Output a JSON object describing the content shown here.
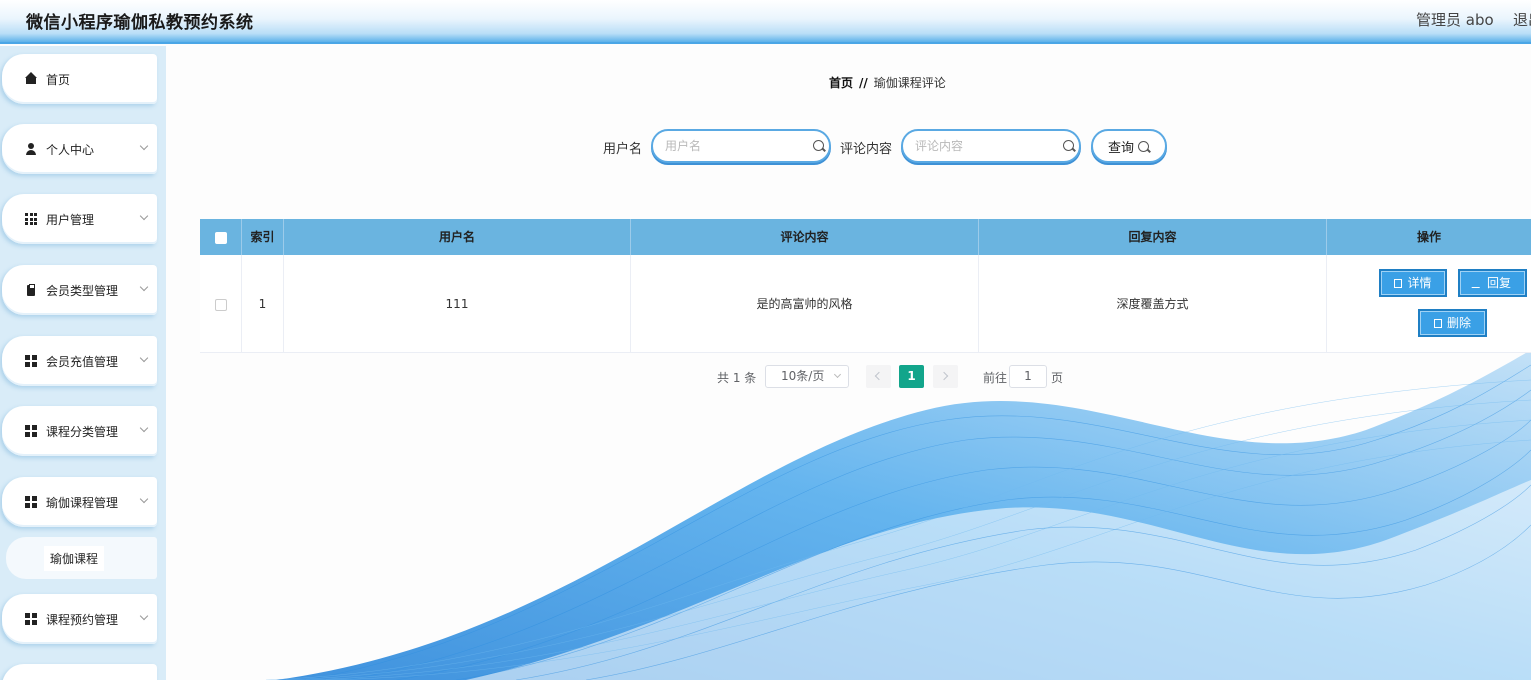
{
  "header": {
    "app_title": "微信小程序瑜伽私教预约系统",
    "admin_text": "管理员 abo",
    "logout_text": "退出"
  },
  "sidebar": {
    "items": [
      {
        "label": "首页",
        "icon": "home-icon",
        "has_arrow": false
      },
      {
        "label": "个人中心",
        "icon": "user-icon",
        "has_arrow": true
      },
      {
        "label": "用户管理",
        "icon": "grid-icon",
        "has_arrow": true
      },
      {
        "label": "会员类型管理",
        "icon": "clipboard-icon",
        "has_arrow": true
      },
      {
        "label": "会员充值管理",
        "icon": "grid-icon",
        "has_arrow": true
      },
      {
        "label": "课程分类管理",
        "icon": "grid-icon",
        "has_arrow": true
      },
      {
        "label": "瑜伽课程管理",
        "icon": "grid-icon",
        "has_arrow": true
      },
      {
        "label": "课程预约管理",
        "icon": "grid-icon",
        "has_arrow": true
      }
    ],
    "submenu_label": "瑜伽课程"
  },
  "breadcrumb": {
    "home": "首页",
    "separator": "//",
    "current": "瑜伽课程评论"
  },
  "search": {
    "username_label": "用户名",
    "username_placeholder": "用户名",
    "comment_label": "评论内容",
    "comment_placeholder": "评论内容",
    "query_button": "查询"
  },
  "table": {
    "columns": [
      "索引",
      "用户名",
      "评论内容",
      "回复内容",
      "操作"
    ],
    "rows": [
      {
        "index": "1",
        "username": "111",
        "comment": "是的高富帅的风格",
        "reply": "深度覆盖方式"
      }
    ],
    "actions": {
      "detail": "详情",
      "reply": "回复",
      "delete": "删除"
    }
  },
  "pagination": {
    "total": "共 1 条",
    "page_size": "10条/页",
    "current_page": "1",
    "goto_label": "前往",
    "goto_value": "1",
    "page_suffix": "页"
  },
  "colors": {
    "header_gradient_end": "#5db2ea",
    "table_header": "#6ab4e0",
    "action_button": "#3aa0e6",
    "active_page": "#12a58b"
  }
}
